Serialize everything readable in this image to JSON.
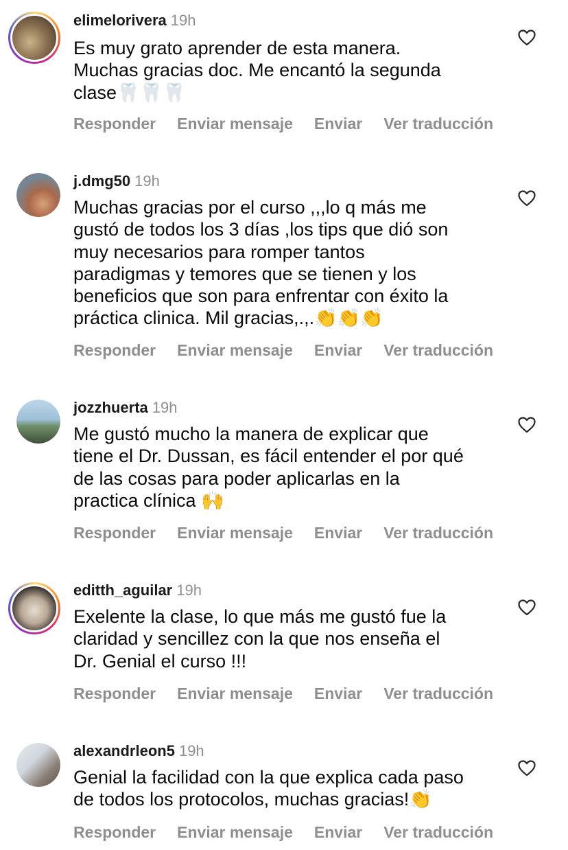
{
  "actions": {
    "reply": "Responder",
    "send_message": "Enviar mensaje",
    "send": "Enviar",
    "translate": "Ver traducción"
  },
  "comments": [
    {
      "username": "elimelorivera",
      "time": "19h",
      "text": "Es muy grato aprender de esta manera.\nMuchas gracias doc. Me encantó la segunda\nclase🦷🦷🦷",
      "story_ring": true
    },
    {
      "username": "j.dmg50",
      "time": "19h",
      "text": "Muchas gracias por el curso ,,,lo q más me\ngustó de todos los 3 días ,los tips que dió son\nmuy necesarios para romper tantos\nparadigmas y temores que se tienen y los\nbeneficios que son para  enfrentar con éxito la\npráctica clinica. Mil gracias,.,.👏👏👏",
      "story_ring": false
    },
    {
      "username": "jozzhuerta",
      "time": "19h",
      "text": "Me gustó mucho la manera de explicar que\ntiene el Dr. Dussan, es fácil entender el por qué\nde las cosas para poder aplicarlas en la\npractica clínica 🙌",
      "story_ring": false
    },
    {
      "username": "editth_aguilar",
      "time": "19h",
      "text": "Exelente la clase, lo que más me gustó fue la\nclaridad y sencillez con la que nos enseña el\nDr. Genial el curso !!!",
      "story_ring": true
    },
    {
      "username": "alexandrleon5",
      "time": "19h",
      "text": "Genial la facilidad con la que explica cada paso\nde todos los protocolos, muchas gracias!👏",
      "story_ring": false
    }
  ]
}
